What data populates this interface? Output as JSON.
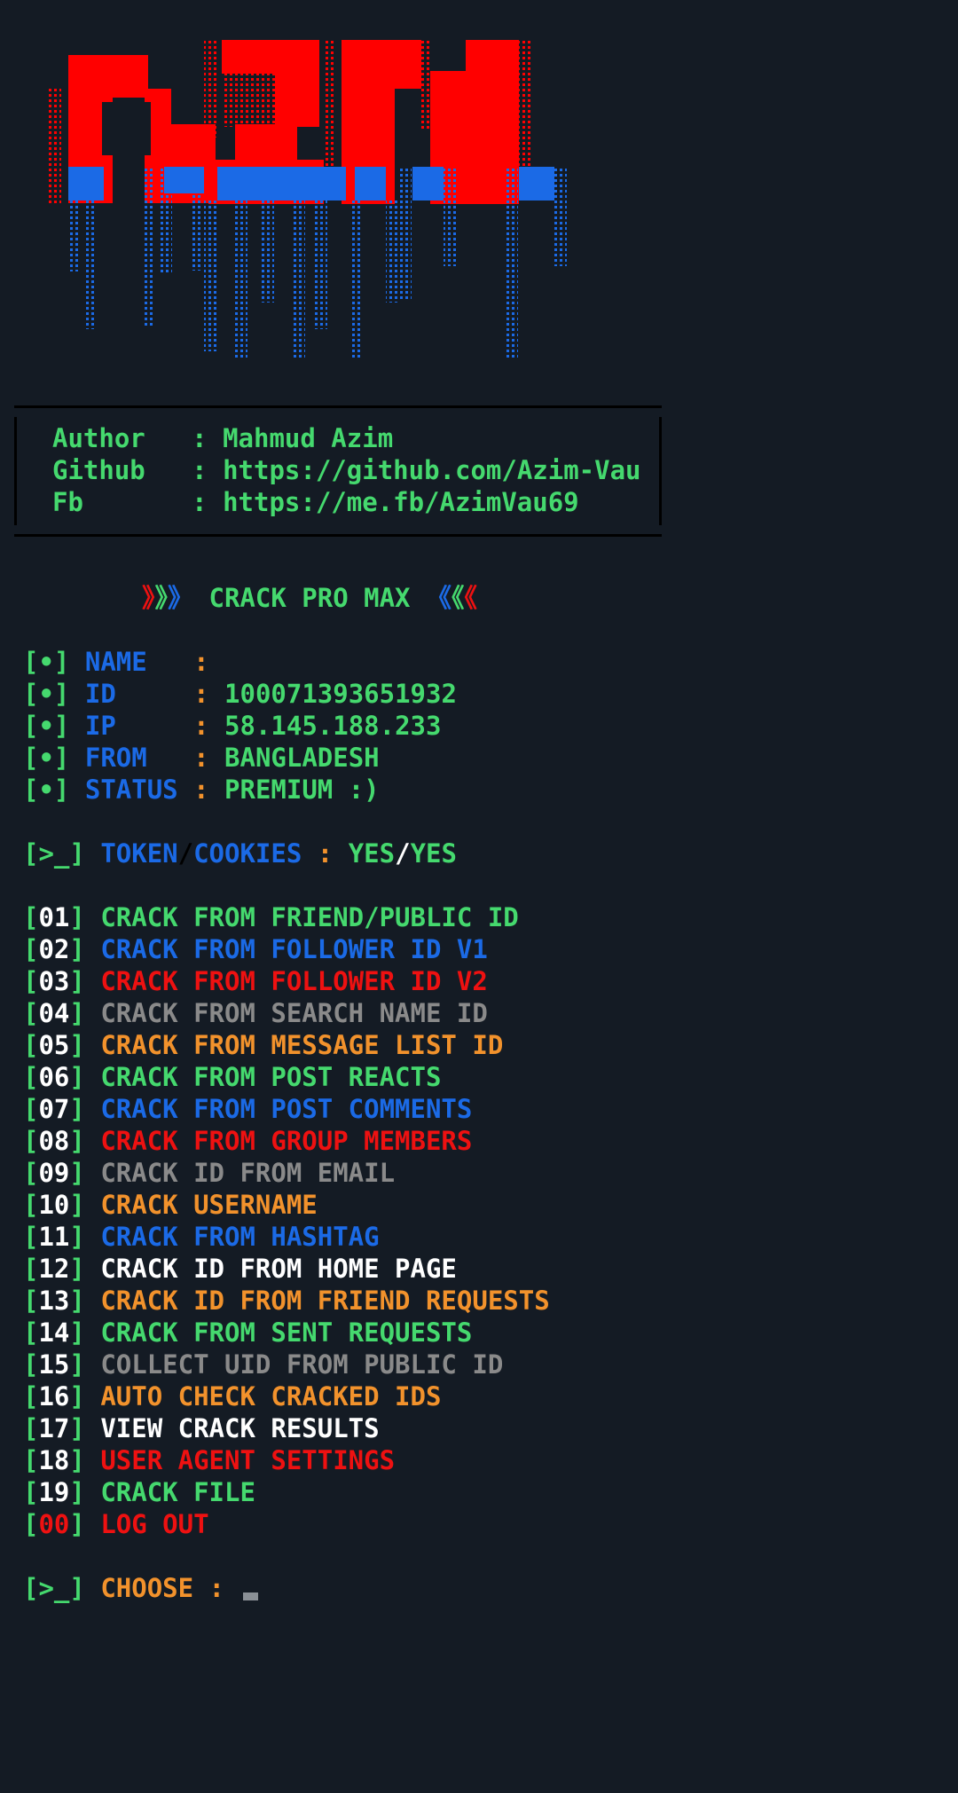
{
  "logo": {
    "text": "AZIM",
    "colors": {
      "top": "#ff0000",
      "bottom": "#1b6ae6"
    }
  },
  "info": {
    "author_label": "Author",
    "author_value": "Mahmud Azim",
    "github_label": "Github",
    "github_value": "https://github.com/Azim-Vau",
    "fb_label": "Fb",
    "fb_value": "https://me.fb/AzimVau69",
    "sep": ":"
  },
  "banner": {
    "left_arrows": [
      "》",
      "》",
      "》"
    ],
    "title": "CRACK PRO MAX",
    "right_arrows": [
      "《",
      "《",
      "《"
    ]
  },
  "user": {
    "bullet": "[•]",
    "name_label": "NAME",
    "name_value": "",
    "id_label": "ID",
    "id_value": "100071393651932",
    "ip_label": "IP",
    "ip_value": "58.145.188.233",
    "from_label": "FROM",
    "from_value": "BANGLADESH",
    "status_label": "STATUS",
    "status_value": "PREMIUM :)",
    "sep": ":"
  },
  "token": {
    "prompt": "[>_]",
    "token_label": "TOKEN",
    "slash": "/",
    "cookies_label": "COOKIES",
    "sep": ":",
    "token_value": "YES",
    "cookies_value": "YES"
  },
  "menu": [
    {
      "num": "01",
      "label": "CRACK FROM FRIEND/PUBLIC ID",
      "color": "#45d96e"
    },
    {
      "num": "02",
      "label": "CRACK FROM FOLLOWER ID V1",
      "color": "#1b6ae6"
    },
    {
      "num": "03",
      "label": "CRACK FROM FOLLOWER ID V2",
      "color": "#ee1111"
    },
    {
      "num": "04",
      "label": "CRACK FROM SEARCH NAME ID",
      "color": "#8a8a8a"
    },
    {
      "num": "05",
      "label": "CRACK FROM MESSAGE LIST ID",
      "color": "#f2922c"
    },
    {
      "num": "06",
      "label": "CRACK FROM POST REACTS",
      "color": "#45d96e"
    },
    {
      "num": "07",
      "label": "CRACK FROM POST COMMENTS",
      "color": "#1b6ae6"
    },
    {
      "num": "08",
      "label": "CRACK FROM GROUP MEMBERS",
      "color": "#ee1111"
    },
    {
      "num": "09",
      "label": "CRACK ID FROM EMAIL",
      "color": "#8a8a8a"
    },
    {
      "num": "10",
      "label": "CRACK USERNAME",
      "color": "#f2922c"
    },
    {
      "num": "11",
      "label": "CRACK FROM HASHTAG",
      "color": "#1b6ae6"
    },
    {
      "num": "12",
      "label": "CRACK ID FROM HOME PAGE",
      "color": "#ffffff"
    },
    {
      "num": "13",
      "label": "CRACK ID FROM FRIEND REQUESTS",
      "color": "#f2922c"
    },
    {
      "num": "14",
      "label": "CRACK FROM SENT REQUESTS",
      "color": "#45d96e"
    },
    {
      "num": "15",
      "label": "COLLECT UID FROM PUBLIC ID",
      "color": "#8a8a8a"
    },
    {
      "num": "16",
      "label": "AUTO CHECK CRACKED IDS",
      "color": "#f2922c"
    },
    {
      "num": "17",
      "label": "VIEW CRACK RESULTS",
      "color": "#ffffff"
    },
    {
      "num": "18",
      "label": "USER AGENT SETTINGS",
      "color": "#ee1111"
    },
    {
      "num": "19",
      "label": "CRACK FILE",
      "color": "#45d96e"
    },
    {
      "num": "00",
      "label": "LOG OUT",
      "color": "#ee1111"
    }
  ],
  "choose": {
    "prompt": "[>_]",
    "label": "CHOOSE",
    "sep": ":"
  }
}
